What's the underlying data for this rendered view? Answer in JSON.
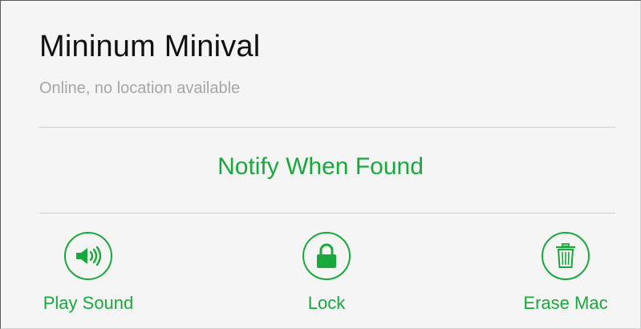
{
  "device": {
    "name": "Mininum Minival",
    "status": "Online, no location available"
  },
  "notify": {
    "label": "Notify When Found"
  },
  "actions": [
    {
      "label": "Play Sound",
      "icon": "speaker-icon"
    },
    {
      "label": "Lock",
      "icon": "lock-icon"
    },
    {
      "label": "Erase Mac",
      "icon": "trash-icon"
    }
  ],
  "colors": {
    "accent": "#19a83b",
    "background": "#f5f5f5",
    "title": "#111111",
    "muted": "#a6a6a6",
    "divider": "#cfcfcf"
  }
}
